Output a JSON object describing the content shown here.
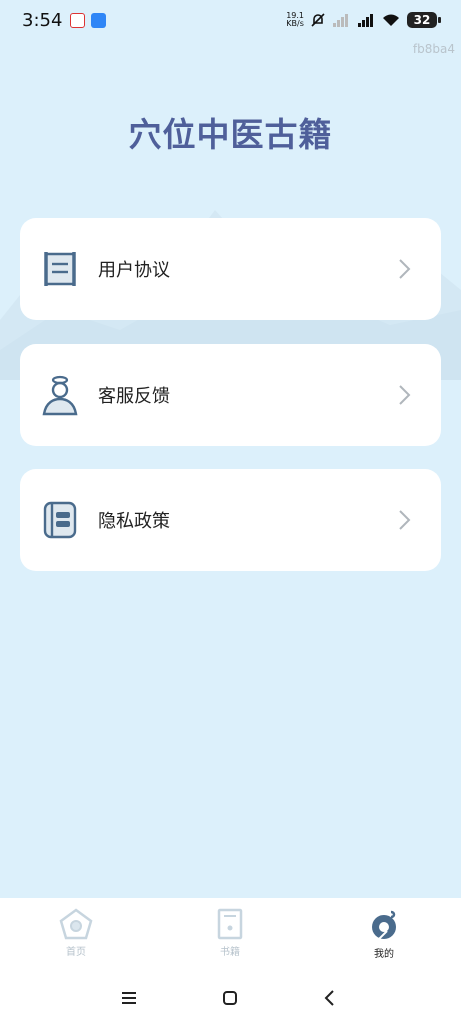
{
  "status_bar": {
    "time": "3:54",
    "net_speed_value": "19.1",
    "net_speed_unit": "KB/s",
    "battery": "32"
  },
  "watermark": "fb8ba4",
  "page_title": "穴位中医古籍",
  "menu": [
    {
      "label": "用户协议",
      "icon": "scroll-icon"
    },
    {
      "label": "客服反馈",
      "icon": "person-icon"
    },
    {
      "label": "隐私政策",
      "icon": "notebook-icon"
    }
  ],
  "bottom_nav": [
    {
      "label": "首页",
      "icon": "home-icon",
      "active": false
    },
    {
      "label": "书籍",
      "icon": "book-icon",
      "active": false
    },
    {
      "label": "我的",
      "icon": "profile-icon",
      "active": true
    }
  ],
  "colors": {
    "background": "#dcf0fb",
    "title": "#4f5f9a",
    "icon": "#4a6b8c",
    "chevron": "#b0b6bc"
  }
}
